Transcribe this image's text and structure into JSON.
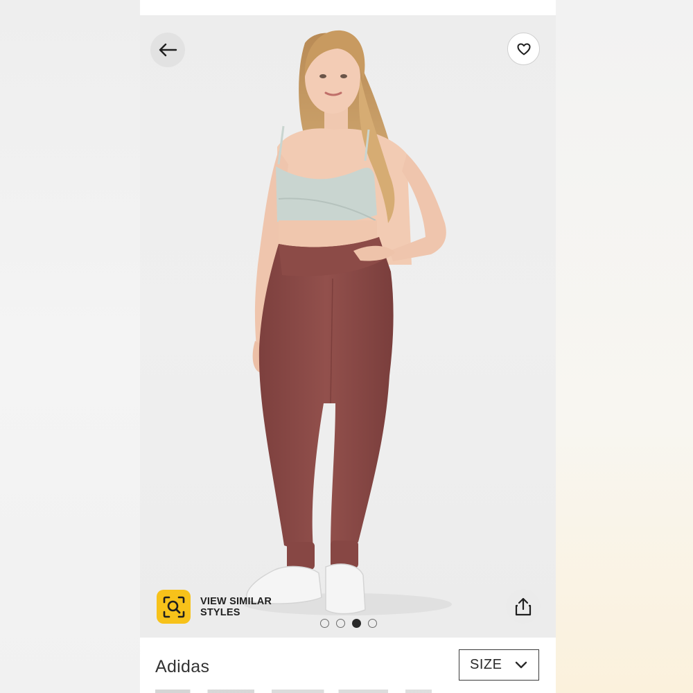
{
  "product": {
    "brand": "Adidas"
  },
  "gallery": {
    "slide_count": 4,
    "active_index": 2
  },
  "actions": {
    "view_similar_line1": "VIEW SIMILAR",
    "view_similar_line2": "STYLES"
  },
  "size_selector": {
    "label": "SIZE"
  },
  "icons": {
    "back": "arrow-left-icon",
    "favorite": "heart-icon",
    "share": "share-icon",
    "visual_search": "visual-search-icon",
    "dropdown": "chevron-down-icon"
  },
  "colors": {
    "accent": "#f7c21a",
    "pants": "#8a4a47",
    "top": "#c9d5d0"
  }
}
